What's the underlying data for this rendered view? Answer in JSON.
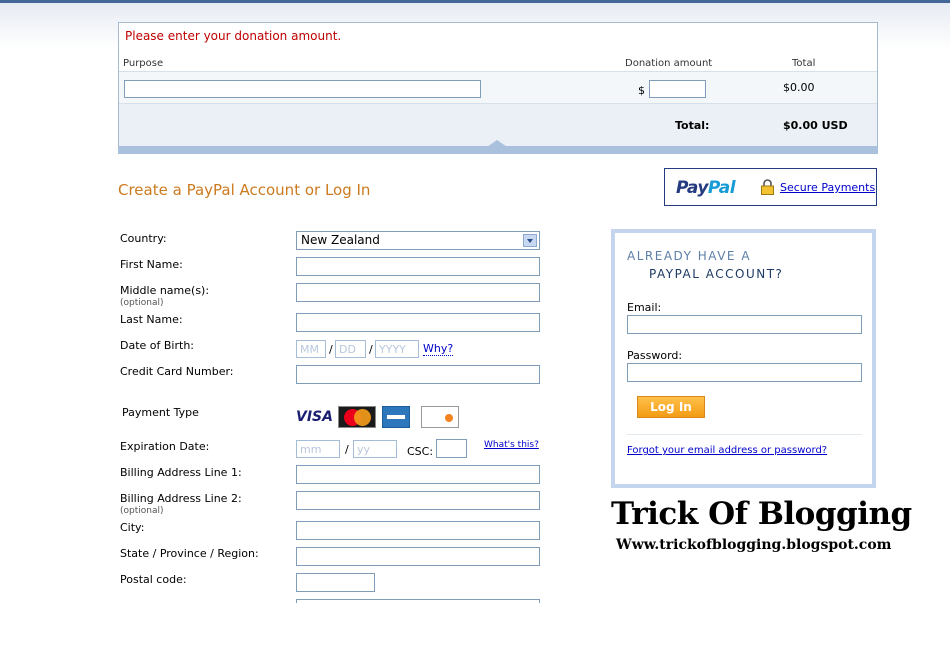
{
  "donation": {
    "error": "Please enter your donation amount.",
    "col_purpose": "Purpose",
    "col_amount": "Donation amount",
    "col_total": "Total",
    "currency_symbol": "$",
    "row_total": "$0.00",
    "total_label": "Total:",
    "total_value": "$0.00 USD"
  },
  "section_title": "Create a PayPal Account or Log In",
  "badge": {
    "logo_pay": "Pay",
    "logo_pal": "Pal",
    "secure_link": "Secure Payments"
  },
  "form": {
    "country_label": "Country:",
    "country_value": "New Zealand",
    "first_name_label": "First Name:",
    "middle_name_label": "Middle name(s):",
    "middle_optional": "(optional)",
    "last_name_label": "Last Name:",
    "dob_label": "Date of Birth:",
    "dob_mm": "MM",
    "dob_dd": "DD",
    "dob_yyyy": "YYYY",
    "dob_sep": "/",
    "why_link": "Why?",
    "card_number_label": "Credit Card Number:",
    "payment_type_label": "Payment Type",
    "card_visa": "VISA",
    "expiration_label": "Expiration Date:",
    "exp_mm": "mm",
    "exp_yy": "yy",
    "csc_label": "CSC:",
    "whats_this": "What's this?",
    "billing1_label": "Billing Address Line 1:",
    "billing2_label": "Billing Address Line 2:",
    "billing2_optional": "(optional)",
    "city_label": "City:",
    "state_label": "State / Province / Region:",
    "postal_label": "Postal code:"
  },
  "login": {
    "heading_line1": "ALREADY HAVE A",
    "heading_line2": "PAYPAL ACCOUNT?",
    "email_label": "Email:",
    "password_label": "Password:",
    "login_button": "Log In",
    "forgot_link": "Forgot your email address or password?"
  },
  "watermark": {
    "title": "Trick Of Blogging",
    "url": "Www.trickofblogging.blogspot.com"
  },
  "colors": {
    "accent_orange": "#cc7a1f",
    "paypal_navy": "#253b80",
    "paypal_blue": "#179bd7",
    "error_red": "#c00000",
    "link_blue": "#0000cc"
  }
}
